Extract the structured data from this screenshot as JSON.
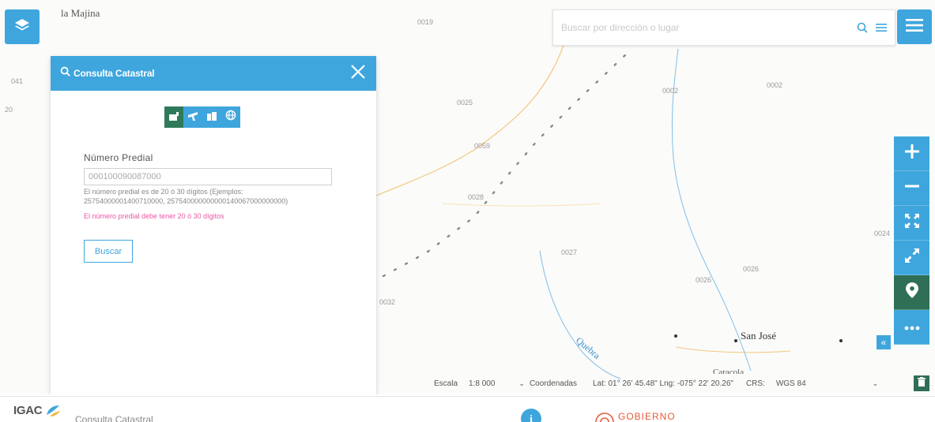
{
  "map": {
    "top_place": "la Majina",
    "parcel_labels": [
      "0019",
      "0025",
      "0059",
      "0028",
      "0032",
      "0027",
      "0026",
      "0026",
      "0002",
      "0002",
      "0024",
      "041",
      "20"
    ],
    "place_name": "San José",
    "stream_name": "Quebra",
    "lower_place_partial": "Caracola"
  },
  "search": {
    "placeholder": "Buscar por dirección o lugar"
  },
  "panel": {
    "title": "Consulta Catastral",
    "field_label": "Número Predial",
    "field_value": "000100090087000",
    "hint": "El número predial es de 20 ó 30 dígitos (Ejemplos: 25754000001400710000, 257540000000000140067000000000)",
    "error": "El número predial debe tener 20 ó 30 dígitos",
    "search_button": "Buscar"
  },
  "status": {
    "scale_label": "Escala",
    "scale_value": "1:8 000",
    "coords_label": "Coordenadas",
    "lat_lng": "Lat: 01° 26' 45.48\" Lng: -075° 22' 20.26\"",
    "crs_label": "CRS:",
    "crs_value": "WGS 84"
  },
  "footer": {
    "logo_text": "IGAC",
    "app_title": "Consulta Catastral",
    "info_symbol": "i",
    "gov_text": "GOBIERNO"
  },
  "icons": {
    "layers": "layers-icon",
    "search": "search-icon",
    "list": "list-icon",
    "hamburger": "hamburger-menu-icon",
    "close": "close-icon",
    "zoom_in": "plus-icon",
    "zoom_out": "minus-icon",
    "fit": "fit-extent-icon",
    "fullscreen": "expand-icon",
    "location": "location-pin-icon",
    "more": "more-dots-icon",
    "collapse": "double-chevron-left-icon",
    "delete": "trash-icon"
  },
  "colors": {
    "accent": "#3ea6dd",
    "active": "#2f6f55",
    "error": "#e85aa5"
  }
}
